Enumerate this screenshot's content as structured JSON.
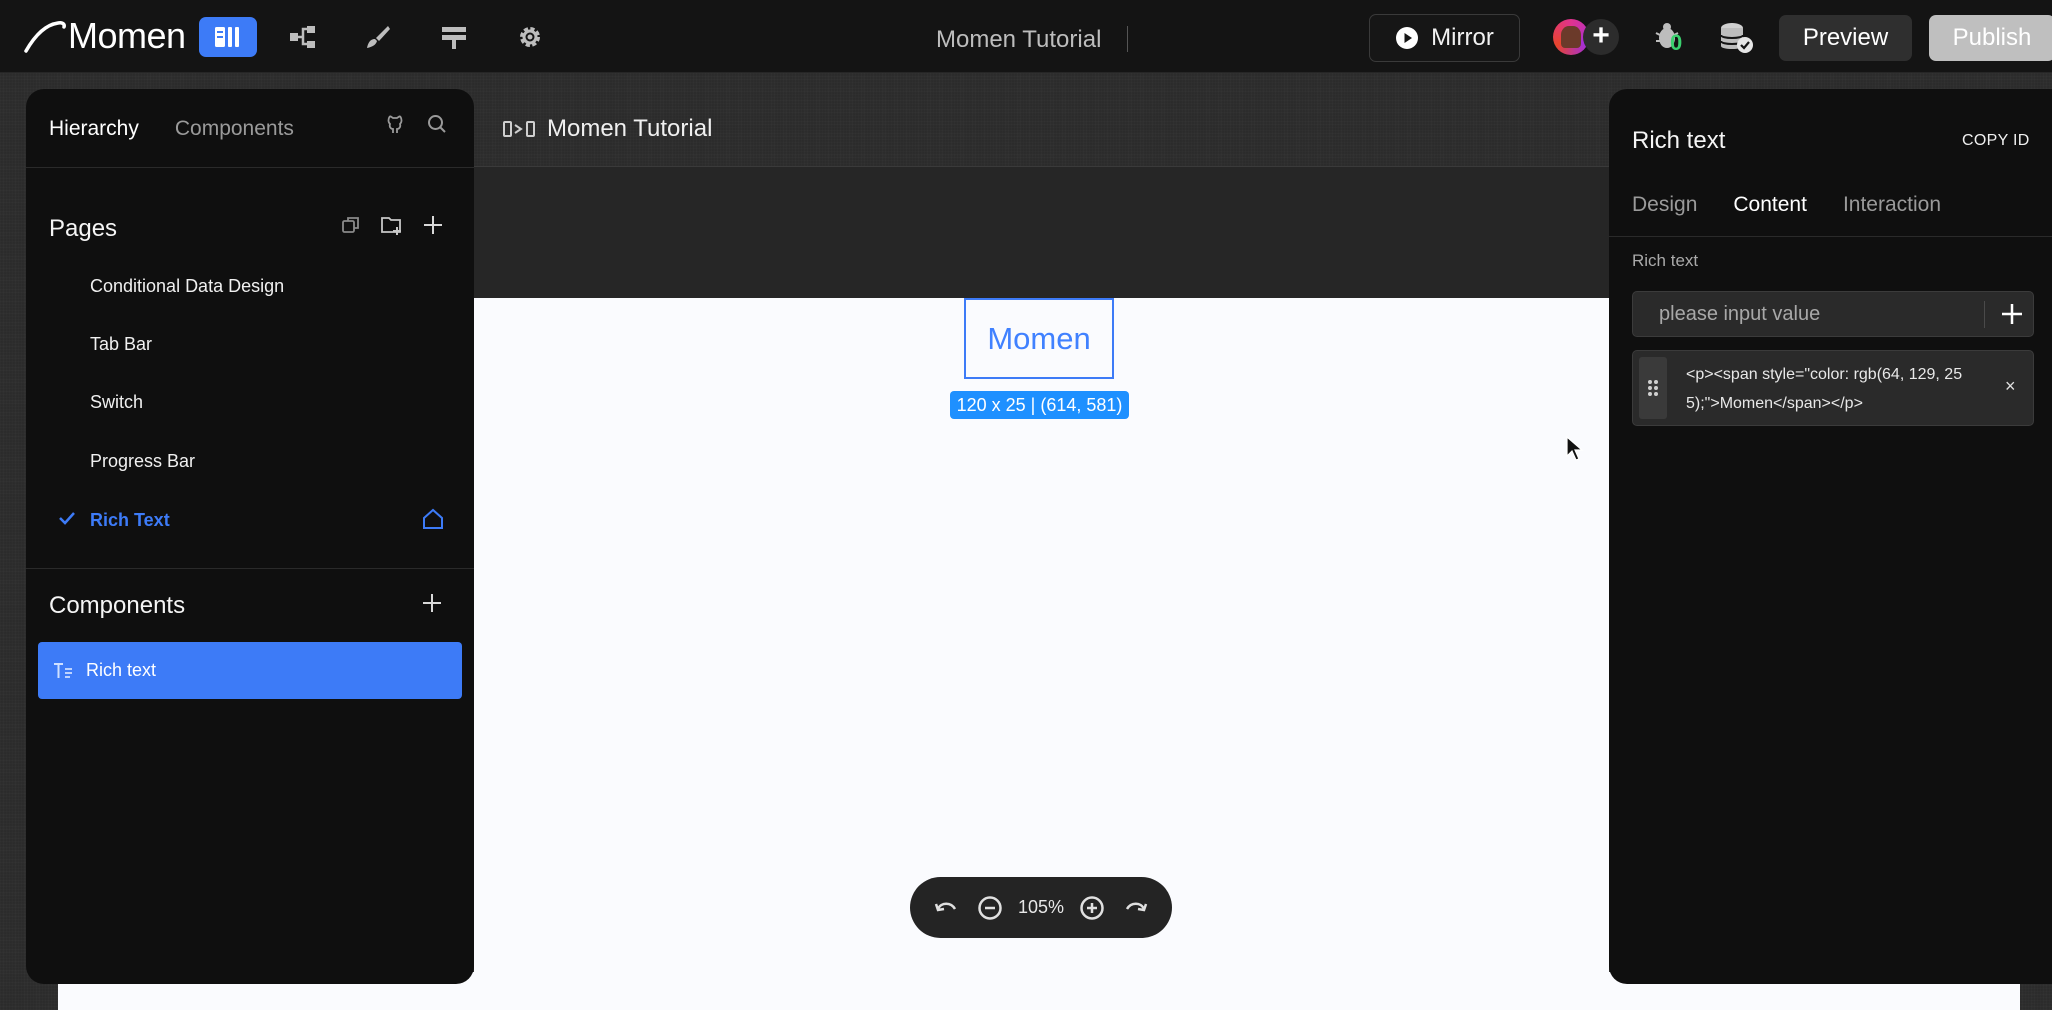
{
  "topbar": {
    "logo_text": "Momen",
    "nav_icons": [
      "layout-icon",
      "hierarchy-icon",
      "brush-icon",
      "data-icon",
      "gear-icon"
    ],
    "document_title": "Momen Tutorial",
    "mirror_label": "Mirror",
    "bug_count": "0",
    "preview_label": "Preview",
    "publish_label": "Publish"
  },
  "left_panel": {
    "tabs": [
      {
        "label": "Hierarchy",
        "active": true
      },
      {
        "label": "Components",
        "active": false
      }
    ],
    "pages_title": "Pages",
    "pages": [
      {
        "label": "Conditional Data Design",
        "selected": false
      },
      {
        "label": "Tab Bar",
        "selected": false
      },
      {
        "label": "Switch",
        "selected": false
      },
      {
        "label": "Progress Bar",
        "selected": false
      },
      {
        "label": "Rich Text",
        "selected": true
      }
    ],
    "components_title": "Components",
    "components": [
      {
        "label": "Rich text",
        "icon": "rich-text-icon",
        "selected": true
      }
    ]
  },
  "canvas": {
    "page_title": "Momen Tutorial",
    "selected_text": "Momen",
    "selection_info": "120 x 25 | (614, 581)",
    "zoom": "105%"
  },
  "right_panel": {
    "title": "Rich text",
    "copy_id_label": "COPY ID",
    "tabs": [
      {
        "label": "Design",
        "active": false
      },
      {
        "label": "Content",
        "active": true
      },
      {
        "label": "Interaction",
        "active": false
      }
    ],
    "field_label": "Rich text",
    "input_placeholder": "please input value",
    "value": "<p><span style=\"color: rgb(64, 129, 255);\">Momen</span></p>"
  },
  "colors": {
    "accent": "#3d7bf7",
    "rich_text_color": "#4081ff",
    "badge": "#1e90ff",
    "panel_bg": "#0f0f0f"
  }
}
